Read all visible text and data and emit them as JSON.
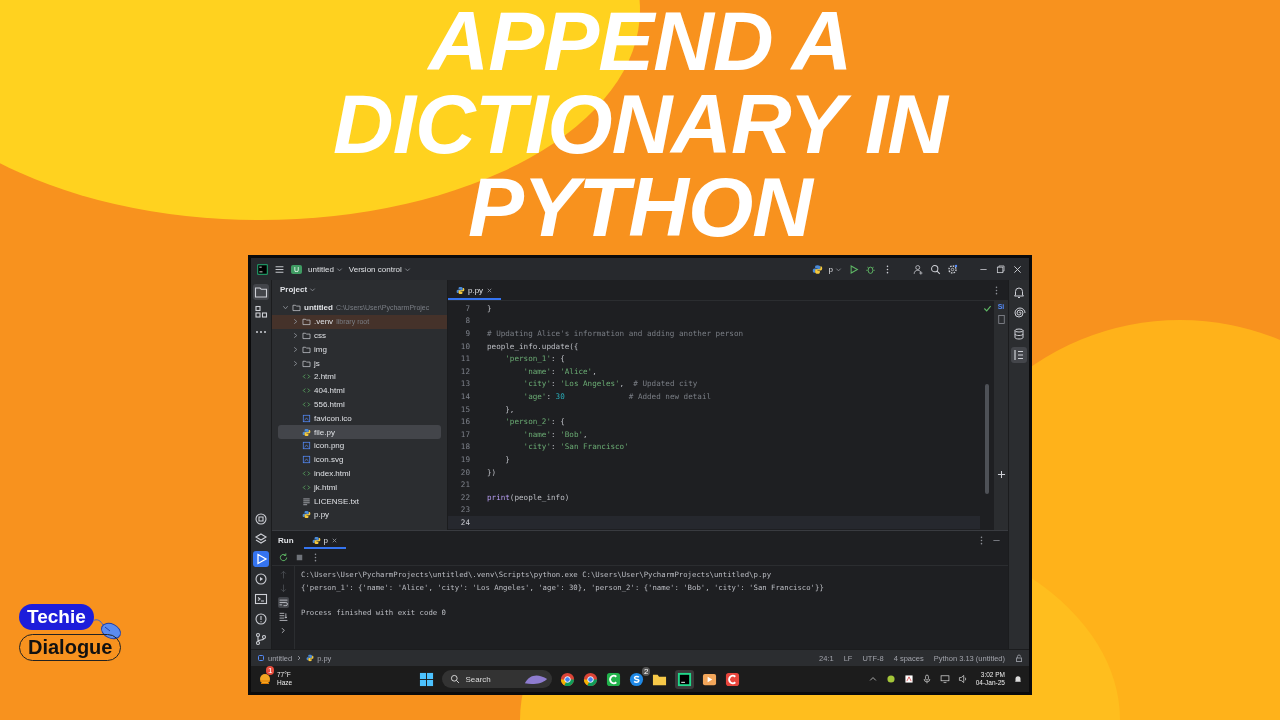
{
  "title_lines": [
    "APPEND A",
    "DICTIONARY IN",
    "PYTHON"
  ],
  "logo": {
    "top": "Techie",
    "bottom": "Dialogue"
  },
  "ide": {
    "titlebar": {
      "project_badge": "U",
      "project": "untitled",
      "vcs": "Version control",
      "run_config": "p"
    },
    "left_stripe_top": [
      {
        "kind": "project",
        "selected": true
      },
      {
        "kind": "structure",
        "selected": false
      },
      {
        "kind": "more",
        "selected": false
      }
    ],
    "left_stripe_bottom": [
      {
        "kind": "python-console",
        "selected": false
      },
      {
        "kind": "layers",
        "selected": false
      },
      {
        "kind": "run",
        "selected": true
      },
      {
        "kind": "services",
        "selected": false
      },
      {
        "kind": "terminal",
        "selected": false
      },
      {
        "kind": "problems",
        "selected": false
      },
      {
        "kind": "git",
        "selected": false
      }
    ],
    "project_panel": {
      "title": "Project",
      "tree": [
        {
          "label": "untitled",
          "kind": "folder",
          "expanded": true,
          "selected": false,
          "hint": "C:\\Users\\User\\PycharmProjec",
          "children": [
            {
              "label": ".venv",
              "kind": "library",
              "expanded": false,
              "selected": false,
              "hint": "library root"
            },
            {
              "label": "css",
              "kind": "folder",
              "expanded": false,
              "selected": false
            },
            {
              "label": "img",
              "kind": "folder",
              "expanded": false,
              "selected": false
            },
            {
              "label": "js",
              "kind": "folder",
              "expanded": false,
              "selected": false
            },
            {
              "label": "2.html",
              "kind": "html",
              "selected": false
            },
            {
              "label": "404.html",
              "kind": "html",
              "selected": false
            },
            {
              "label": "556.html",
              "kind": "html",
              "selected": false
            },
            {
              "label": "favicon.ico",
              "kind": "image",
              "selected": false
            },
            {
              "label": "file.py",
              "kind": "python",
              "selected": true
            },
            {
              "label": "icon.png",
              "kind": "image",
              "selected": false
            },
            {
              "label": "icon.svg",
              "kind": "image",
              "selected": false
            },
            {
              "label": "index.html",
              "kind": "html",
              "selected": false
            },
            {
              "label": "jk.html",
              "kind": "html",
              "selected": false
            },
            {
              "label": "LICENSE.txt",
              "kind": "text",
              "selected": false
            },
            {
              "label": "p.py",
              "kind": "python",
              "selected": false
            }
          ]
        }
      ]
    },
    "editor": {
      "tabs": [
        {
          "label": "p.py",
          "selected": true
        }
      ],
      "right_label": "Si",
      "lines": [
        {
          "number": "7",
          "current": false,
          "segments": [
            {
              "kind": "plain",
              "text": "}"
            }
          ]
        },
        {
          "number": "8",
          "current": false
        },
        {
          "number": "9",
          "current": false,
          "segments": [
            {
              "kind": "comment",
              "text": "# Updating Alice's information and adding another person"
            }
          ]
        },
        {
          "number": "10",
          "current": false,
          "segments": [
            {
              "kind": "plain",
              "text": "people_info.update({"
            }
          ]
        },
        {
          "number": "11",
          "current": false,
          "segments": [
            {
              "kind": "string",
              "text": "    'person_1'"
            },
            {
              "kind": "plain",
              "text": ": {"
            }
          ]
        },
        {
          "number": "12",
          "current": false,
          "segments": [
            {
              "kind": "string",
              "text": "        'name'"
            },
            {
              "kind": "plain",
              "text": ": "
            },
            {
              "kind": "string",
              "text": "'Alice'"
            },
            {
              "kind": "plain",
              "text": ","
            }
          ]
        },
        {
          "number": "13",
          "current": false,
          "segments": [
            {
              "kind": "string",
              "text": "        'city'"
            },
            {
              "kind": "plain",
              "text": ": "
            },
            {
              "kind": "string",
              "text": "'Los Angeles'"
            },
            {
              "kind": "plain",
              "text": ",  "
            },
            {
              "kind": "comment",
              "text": "# Updated city"
            }
          ]
        },
        {
          "number": "14",
          "current": false,
          "segments": [
            {
              "kind": "string",
              "text": "        'age'"
            },
            {
              "kind": "plain",
              "text": ": "
            },
            {
              "kind": "number",
              "text": "30"
            },
            {
              "kind": "comment",
              "text": "              # Added new detail"
            }
          ]
        },
        {
          "number": "15",
          "current": false,
          "segments": [
            {
              "kind": "plain",
              "text": "    },"
            }
          ]
        },
        {
          "number": "16",
          "current": false,
          "segments": [
            {
              "kind": "string",
              "text": "    'person_2'"
            },
            {
              "kind": "plain",
              "text": ": {"
            }
          ]
        },
        {
          "number": "17",
          "current": false,
          "segments": [
            {
              "kind": "string",
              "text": "        'name'"
            },
            {
              "kind": "plain",
              "text": ": "
            },
            {
              "kind": "string",
              "text": "'Bob'"
            },
            {
              "kind": "plain",
              "text": ","
            }
          ]
        },
        {
          "number": "18",
          "current": false,
          "segments": [
            {
              "kind": "string",
              "text": "        'city'"
            },
            {
              "kind": "plain",
              "text": ": "
            },
            {
              "kind": "string",
              "text": "'San Francisco'"
            }
          ]
        },
        {
          "number": "19",
          "current": false,
          "segments": [
            {
              "kind": "plain",
              "text": "    }"
            }
          ]
        },
        {
          "number": "20",
          "current": false,
          "segments": [
            {
              "kind": "plain",
              "text": "})"
            }
          ]
        },
        {
          "number": "21",
          "current": false
        },
        {
          "number": "22",
          "current": false,
          "segments": [
            {
              "kind": "function",
              "text": "print"
            },
            {
              "kind": "plain",
              "text": "(people_info)"
            }
          ]
        },
        {
          "number": "23",
          "current": false
        },
        {
          "number": "24",
          "current": true
        }
      ]
    },
    "run_panel": {
      "title": "Run",
      "tabs": [
        {
          "label": "p",
          "selected": true
        }
      ],
      "output": [
        "C:\\Users\\User\\PycharmProjects\\untitled\\.venv\\Scripts\\python.exe C:\\Users\\User\\PycharmProjects\\untitled\\p.py",
        "{'person_1': {'name': 'Alice', 'city': 'Los Angeles', 'age': 30}, 'person_2': {'name': 'Bob', 'city': 'San Francisco'}}"
      ],
      "exit_message": "Process finished with exit code 0"
    },
    "status_bar": {
      "breadcrumb": [
        "untitled",
        "p.py"
      ],
      "items": [
        "24:1",
        "LF",
        "UTF-8",
        "4 spaces",
        "Python 3.13 (untitled)"
      ]
    },
    "taskbar": {
      "weather_badge": "1",
      "temperature": "77°F",
      "condition": "Haze",
      "search_label": "Search",
      "chat_badge": "2",
      "time": "3:02 PM",
      "date": "04-Jan-25"
    }
  }
}
